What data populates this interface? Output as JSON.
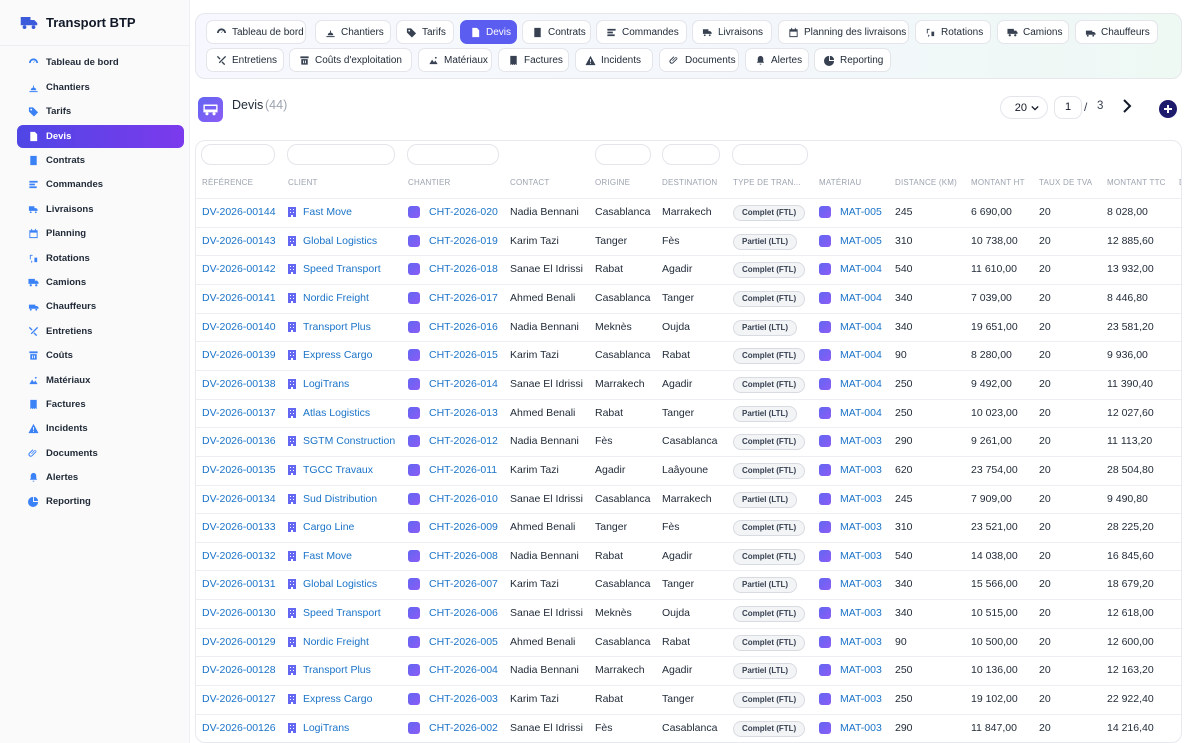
{
  "app": {
    "title": "Transport BTP"
  },
  "sidebar": {
    "items": [
      {
        "label": "Tableau de bord",
        "icon": "dashboard-icon"
      },
      {
        "label": "Chantiers",
        "icon": "construction-icon"
      },
      {
        "label": "Tarifs",
        "icon": "tag-icon"
      },
      {
        "label": "Devis",
        "icon": "document-icon",
        "active": true
      },
      {
        "label": "Contrats",
        "icon": "contract-icon"
      },
      {
        "label": "Commandes",
        "icon": "orders-icon"
      },
      {
        "label": "Livraisons",
        "icon": "delivery-icon"
      },
      {
        "label": "Planning",
        "icon": "calendar-icon"
      },
      {
        "label": "Rotations",
        "icon": "rotation-icon"
      },
      {
        "label": "Camions",
        "icon": "truck-icon"
      },
      {
        "label": "Chauffeurs",
        "icon": "driver-icon"
      },
      {
        "label": "Entretiens",
        "icon": "tools-icon"
      },
      {
        "label": "Coûts",
        "icon": "cost-icon"
      },
      {
        "label": "Matériaux",
        "icon": "materials-icon"
      },
      {
        "label": "Factures",
        "icon": "invoice-icon"
      },
      {
        "label": "Incidents",
        "icon": "warning-icon"
      },
      {
        "label": "Documents",
        "icon": "paperclip-icon"
      },
      {
        "label": "Alertes",
        "icon": "bell-icon"
      },
      {
        "label": "Reporting",
        "icon": "pie-chart-icon"
      }
    ]
  },
  "tabs": [
    {
      "label": "Tableau de bord",
      "icon": "dashboard-icon"
    },
    {
      "label": "Chantiers",
      "icon": "construction-icon"
    },
    {
      "label": "Tarifs",
      "icon": "tag-icon"
    },
    {
      "label": "Devis",
      "icon": "document-icon",
      "active": true
    },
    {
      "label": "Contrats",
      "icon": "contract-icon"
    },
    {
      "label": "Commandes",
      "icon": "orders-icon"
    },
    {
      "label": "Livraisons",
      "icon": "delivery-icon"
    },
    {
      "label": "Planning des livraisons",
      "icon": "calendar-icon"
    },
    {
      "label": "Rotations",
      "icon": "rotation-icon"
    },
    {
      "label": "Camions",
      "icon": "truck-icon"
    },
    {
      "label": "Chauffeurs",
      "icon": "driver-icon"
    },
    {
      "label": "Entretiens",
      "icon": "tools-icon"
    },
    {
      "label": "Coûts d'exploitation",
      "icon": "cost-icon"
    },
    {
      "label": "Matériaux",
      "icon": "materials-icon"
    },
    {
      "label": "Factures",
      "icon": "invoice-icon"
    },
    {
      "label": "Incidents",
      "icon": "warning-icon"
    },
    {
      "label": "Documents",
      "icon": "paperclip-icon"
    },
    {
      "label": "Alertes",
      "icon": "bell-icon"
    },
    {
      "label": "Reporting",
      "icon": "pie-chart-icon"
    }
  ],
  "page": {
    "title": "Devis",
    "count": "(44)",
    "per_page": "20",
    "current_page": "1",
    "separator": "/",
    "total_pages": "3"
  },
  "table": {
    "columns": [
      "Référence",
      "Client",
      "Chantier",
      "Contact",
      "Origine",
      "Destination",
      "Type de tran...",
      "Matériau",
      "Distance (km)",
      "Montant HT",
      "Taux de TVA",
      "Montant TTC",
      "D"
    ],
    "rows": [
      [
        "DV-2026-00144",
        "Fast Move",
        "CHT-2026-020",
        "Nadia Bennani",
        "Casablanca",
        "Marrakech",
        "Complet (FTL)",
        "MAT-005",
        "245",
        "6 690,00",
        "20",
        "8 028,00"
      ],
      [
        "DV-2026-00143",
        "Global Logistics",
        "CHT-2026-019",
        "Karim Tazi",
        "Tanger",
        "Fès",
        "Partiel (LTL)",
        "MAT-005",
        "310",
        "10 738,00",
        "20",
        "12 885,60"
      ],
      [
        "DV-2026-00142",
        "Speed Transport",
        "CHT-2026-018",
        "Sanae El Idrissi",
        "Rabat",
        "Agadir",
        "Complet (FTL)",
        "MAT-004",
        "540",
        "11 610,00",
        "20",
        "13 932,00"
      ],
      [
        "DV-2026-00141",
        "Nordic Freight",
        "CHT-2026-017",
        "Ahmed Benali",
        "Casablanca",
        "Tanger",
        "Complet (FTL)",
        "MAT-004",
        "340",
        "7 039,00",
        "20",
        "8 446,80"
      ],
      [
        "DV-2026-00140",
        "Transport Plus",
        "CHT-2026-016",
        "Nadia Bennani",
        "Meknès",
        "Oujda",
        "Partiel (LTL)",
        "MAT-004",
        "340",
        "19 651,00",
        "20",
        "23 581,20"
      ],
      [
        "DV-2026-00139",
        "Express Cargo",
        "CHT-2026-015",
        "Karim Tazi",
        "Casablanca",
        "Rabat",
        "Complet (FTL)",
        "MAT-004",
        "90",
        "8 280,00",
        "20",
        "9 936,00"
      ],
      [
        "DV-2026-00138",
        "LogiTrans",
        "CHT-2026-014",
        "Sanae El Idrissi",
        "Marrakech",
        "Agadir",
        "Complet (FTL)",
        "MAT-004",
        "250",
        "9 492,00",
        "20",
        "11 390,40"
      ],
      [
        "DV-2026-00137",
        "Atlas Logistics",
        "CHT-2026-013",
        "Ahmed Benali",
        "Rabat",
        "Tanger",
        "Partiel (LTL)",
        "MAT-004",
        "250",
        "10 023,00",
        "20",
        "12 027,60"
      ],
      [
        "DV-2026-00136",
        "SGTM Construction",
        "CHT-2026-012",
        "Nadia Bennani",
        "Fès",
        "Casablanca",
        "Complet (FTL)",
        "MAT-003",
        "290",
        "9 261,00",
        "20",
        "11 113,20"
      ],
      [
        "DV-2026-00135",
        "TGCC Travaux",
        "CHT-2026-011",
        "Karim Tazi",
        "Agadir",
        "Laâyoune",
        "Complet (FTL)",
        "MAT-003",
        "620",
        "23 754,00",
        "20",
        "28 504,80"
      ],
      [
        "DV-2026-00134",
        "Sud Distribution",
        "CHT-2026-010",
        "Sanae El Idrissi",
        "Casablanca",
        "Marrakech",
        "Partiel (LTL)",
        "MAT-003",
        "245",
        "7 909,00",
        "20",
        "9 490,80"
      ],
      [
        "DV-2026-00133",
        "Cargo Line",
        "CHT-2026-009",
        "Ahmed Benali",
        "Tanger",
        "Fès",
        "Complet (FTL)",
        "MAT-003",
        "310",
        "23 521,00",
        "20",
        "28 225,20"
      ],
      [
        "DV-2026-00132",
        "Fast Move",
        "CHT-2026-008",
        "Nadia Bennani",
        "Rabat",
        "Agadir",
        "Complet (FTL)",
        "MAT-003",
        "540",
        "14 038,00",
        "20",
        "16 845,60"
      ],
      [
        "DV-2026-00131",
        "Global Logistics",
        "CHT-2026-007",
        "Karim Tazi",
        "Casablanca",
        "Tanger",
        "Partiel (LTL)",
        "MAT-003",
        "340",
        "15 566,00",
        "20",
        "18 679,20"
      ],
      [
        "DV-2026-00130",
        "Speed Transport",
        "CHT-2026-006",
        "Sanae El Idrissi",
        "Meknès",
        "Oujda",
        "Complet (FTL)",
        "MAT-003",
        "340",
        "10 515,00",
        "20",
        "12 618,00"
      ],
      [
        "DV-2026-00129",
        "Nordic Freight",
        "CHT-2026-005",
        "Ahmed Benali",
        "Casablanca",
        "Rabat",
        "Complet (FTL)",
        "MAT-003",
        "90",
        "10 500,00",
        "20",
        "12 600,00"
      ],
      [
        "DV-2026-00128",
        "Transport Plus",
        "CHT-2026-004",
        "Nadia Bennani",
        "Marrakech",
        "Agadir",
        "Partiel (LTL)",
        "MAT-003",
        "250",
        "10 136,00",
        "20",
        "12 163,20"
      ],
      [
        "DV-2026-00127",
        "Express Cargo",
        "CHT-2026-003",
        "Karim Tazi",
        "Rabat",
        "Tanger",
        "Complet (FTL)",
        "MAT-003",
        "250",
        "19 102,00",
        "20",
        "22 922,40"
      ],
      [
        "DV-2026-00126",
        "LogiTrans",
        "CHT-2026-002",
        "Sanae El Idrissi",
        "Fès",
        "Casablanca",
        "Complet (FTL)",
        "MAT-003",
        "290",
        "11 847,00",
        "20",
        "14 216,40"
      ]
    ]
  },
  "colors": {
    "accent": "#5b5cf0",
    "link": "#1a73c8",
    "sidebar_icon": "#3b82f6"
  }
}
